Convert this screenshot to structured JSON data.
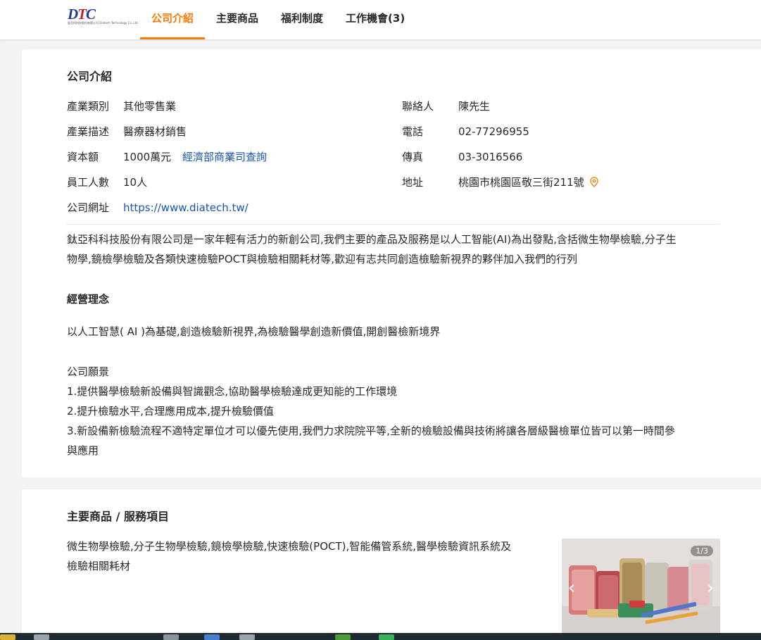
{
  "nav": {
    "logo_text": "DTC",
    "logo_sub": "鈦亞科科技股份有限公司 Diatech Technology Co.,Ltd",
    "tabs": [
      "公司介紹",
      "主要商品",
      "福利制度",
      "工作機會(3)"
    ],
    "active_tab": 0
  },
  "company": {
    "section_title": "公司介紹",
    "left": [
      {
        "label": "產業類別",
        "value": "其他零售業"
      },
      {
        "label": "產業描述",
        "value": "醫療器材銷售"
      },
      {
        "label": "資本額",
        "value": "1000萬元",
        "link": "經濟部商業司查詢"
      },
      {
        "label": "員工人數",
        "value": "10人"
      },
      {
        "label": "公司網址",
        "link": "https://www.diatech.tw/"
      }
    ],
    "right": [
      {
        "label": "聯絡人",
        "value": "陳先生"
      },
      {
        "label": "電話",
        "value": "02-77296955"
      },
      {
        "label": "傳真",
        "value": "03-3016566"
      },
      {
        "label": "地址",
        "value": "桃園市桃園區敬三街211號"
      }
    ],
    "intro_lines": [
      "鈦亞科科技股份有限公司是一家年輕有活力的新創公司,我們主要的產品及服務是以人工智能(AI)為出發點,含括微生物學檢驗,分子生",
      "物學,鏡檢學檢驗及各類快速檢驗POCT與檢驗相關耗材等,歡迎有志共同創造檢驗新視界的夥伴加入我們的行列"
    ],
    "philosophy_title": "經營理念",
    "philosophy_text": "以人工智慧( AI )為基礎,創造檢驗新視界,為檢驗醫學創造新價值,開創醫檢新境界",
    "vision_lines": [
      "公司願景",
      "1.提供醫學檢驗新設備與智識觀念,協助醫學檢驗達成更知能的工作環境",
      "2.提升檢驗水平,合理應用成本,提升檢驗價值",
      "3.新設備新檢驗流程不適特定單位才可以優先使用,我們力求院院平等,全新的檢驗設備與技術將讓各層級醫檢單位皆可以第一時間參",
      "與應用"
    ]
  },
  "products": {
    "section_title": "主要商品 / 服務項目",
    "text_lines": [
      "微生物學檢驗,分子生物學檢驗,鏡檢學檢驗,快速檢驗(POCT),智能備管系統,醫學檢驗資訊系統及",
      "檢驗相關耗材"
    ],
    "gallery_counter": "1/3",
    "prev_icon": "chevron-left-icon",
    "next_icon": "chevron-right-icon"
  },
  "colors": {
    "accent": "#ff7800",
    "link": "#1654b9",
    "background": "#f3f3f3",
    "card": "#ffffff"
  }
}
